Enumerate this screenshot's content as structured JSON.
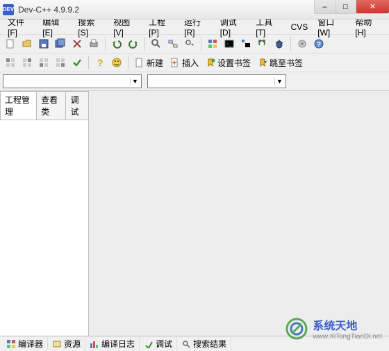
{
  "window": {
    "title": "Dev-C++ 4.9.9.2",
    "app_abbr": "DEV",
    "controls": {
      "min": "–",
      "max": "□",
      "close": "✕"
    }
  },
  "menu": {
    "items": [
      "文件[F]",
      "编辑[E]",
      "搜索[S]",
      "视图[V]",
      "工程[P]",
      "运行[R]",
      "调试[D]",
      "工具[T]",
      "CVS",
      "窗口[W]",
      "帮助[H]"
    ]
  },
  "toolbar1": {
    "icons": [
      "new-file-icon",
      "open-icon",
      "save-icon",
      "save-all-icon",
      "close-icon",
      "print-icon"
    ],
    "icons2": [
      "undo-icon",
      "redo-icon"
    ],
    "icons3": [
      "find-icon",
      "replace-icon",
      "find-next-icon"
    ],
    "icons4": [
      "compile-icon",
      "run-icon",
      "compile-run-icon",
      "rebuild-icon",
      "debug-icon"
    ],
    "icons5": [
      "options-icon",
      "help-icon"
    ]
  },
  "toolbar2": {
    "layout_icons": [
      "pane1-icon",
      "pane2-icon",
      "pane3-icon",
      "pane4-icon"
    ],
    "check_icon": "check-icon",
    "help_icon": "qmark-icon",
    "smile_icon": "smile-icon",
    "new_btn": {
      "label": "新建"
    },
    "insert_btn": {
      "label": "插入"
    },
    "set_bm_btn": {
      "label": "设置书签"
    },
    "goto_bm_btn": {
      "label": "跳至书签"
    }
  },
  "combos": {
    "combo1": "",
    "combo2": ""
  },
  "side": {
    "tabs": [
      "工程管理",
      "查看类",
      "调试"
    ]
  },
  "bottom": {
    "tabs": [
      {
        "label": "编译器"
      },
      {
        "label": "资源"
      },
      {
        "label": "编译日志"
      },
      {
        "label": "调试"
      },
      {
        "label": "搜索结果"
      }
    ]
  },
  "watermark": {
    "zh": "系统天地",
    "url": "www.XiTongTianDi.net"
  }
}
